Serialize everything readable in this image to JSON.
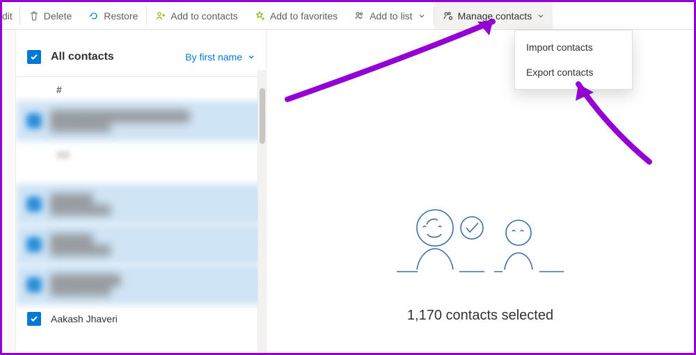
{
  "toolbar": {
    "edit_fragment": "dit",
    "delete_label": "Delete",
    "restore_label": "Restore",
    "add_contacts_label": "Add to contacts",
    "add_favorites_label": "Add to favorites",
    "add_list_label": "Add to list",
    "manage_label": "Manage contacts"
  },
  "menu": {
    "import_label": "Import contacts",
    "export_label": "Export contacts"
  },
  "list_header": {
    "title": "All contacts",
    "sort_label": "By first name"
  },
  "groups": [
    {
      "letter": "#"
    }
  ],
  "rows": [
    {
      "name": "",
      "sub": "",
      "selected": true,
      "blurred": true
    },
    {
      "name": "",
      "sub": "",
      "selected": true,
      "blurred": true
    },
    {
      "name": "",
      "sub": "",
      "selected": true,
      "blurred": true
    },
    {
      "name": "",
      "sub": "",
      "selected": true,
      "blurred": true
    },
    {
      "name": "Aakash Jhaveri",
      "sub": "",
      "selected": true,
      "blurred": false
    }
  ],
  "detail": {
    "selected_text": "1,170 contacts selected"
  },
  "colors": {
    "accent": "#0078d4",
    "annotation": "#9400d3"
  }
}
